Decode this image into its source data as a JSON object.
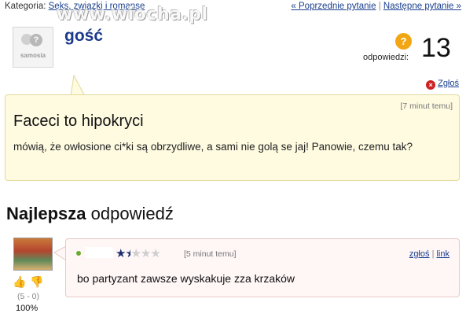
{
  "header": {
    "category_label": "Kategoria:",
    "category_link": "Seks, związki i romanse",
    "prev_link": "« Poprzednie pytanie",
    "separator": "|",
    "next_link": "Następne pytanie »",
    "watermark": "www.wiocha.pl"
  },
  "asker": {
    "avatar_text": "samosia",
    "avatar_glyph": "?",
    "name": "gość"
  },
  "answers": {
    "icon_glyph": "?",
    "label": "odpowiedzi:",
    "count": "13"
  },
  "report": {
    "icon_glyph": "×",
    "label": "Zgłoś"
  },
  "question": {
    "time": "[7 minut temu]",
    "title": "Faceci to hipokryci",
    "body": "mówią, że owłosione ci*ki są obrzydliwe, a sami nie golą se jaj! Panowie, czemu tak?"
  },
  "best_answer": {
    "heading_bold": "Najlepsza",
    "heading_rest": "odpowiedź",
    "rating": {
      "value": 1.5,
      "max": 5,
      "filled": "★",
      "half": "★",
      "empty": "★★★"
    },
    "time": "[5 minut temu]",
    "report_link": "zgłoś",
    "links_separator": "|",
    "link_link": "link",
    "body": "bo partyzant zawsze wyskakuje zza krzaków",
    "thumb_up": "👍",
    "thumb_down": "👎",
    "votes": "(5 - 0)",
    "percent": "100%"
  },
  "colors": {
    "link": "#1a3f8f",
    "question_bg": "#fffbe1",
    "answer_bg": "#fff6f6",
    "answers_icon": "#f2a614",
    "report_icon": "#cc2222",
    "online_dot": "#6aaa2c"
  }
}
